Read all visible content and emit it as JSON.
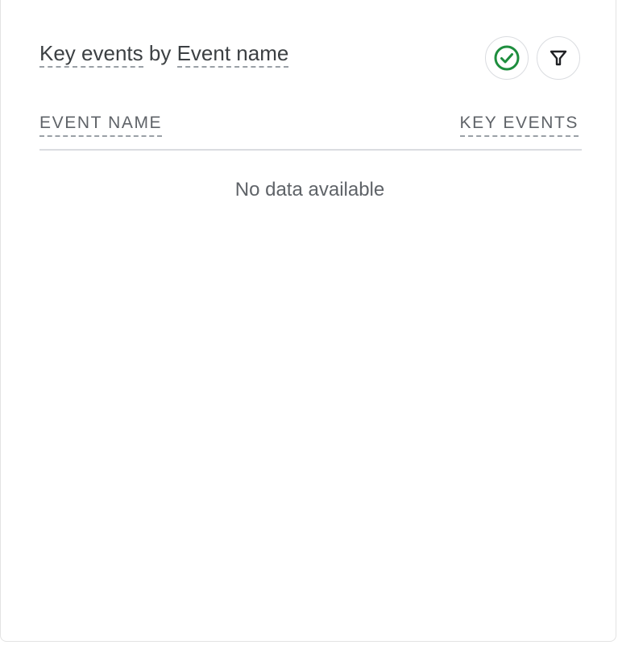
{
  "card": {
    "title_metric": "Key events",
    "title_connector": "by",
    "title_dimension": "Event name"
  },
  "actions": {
    "status_icon": "check-circle-icon",
    "status_color": "#1e8e3e",
    "filter_icon": "filter-icon"
  },
  "table": {
    "columns": [
      "EVENT NAME",
      "KEY EVENTS"
    ],
    "rows": []
  },
  "empty_state": "No data available"
}
